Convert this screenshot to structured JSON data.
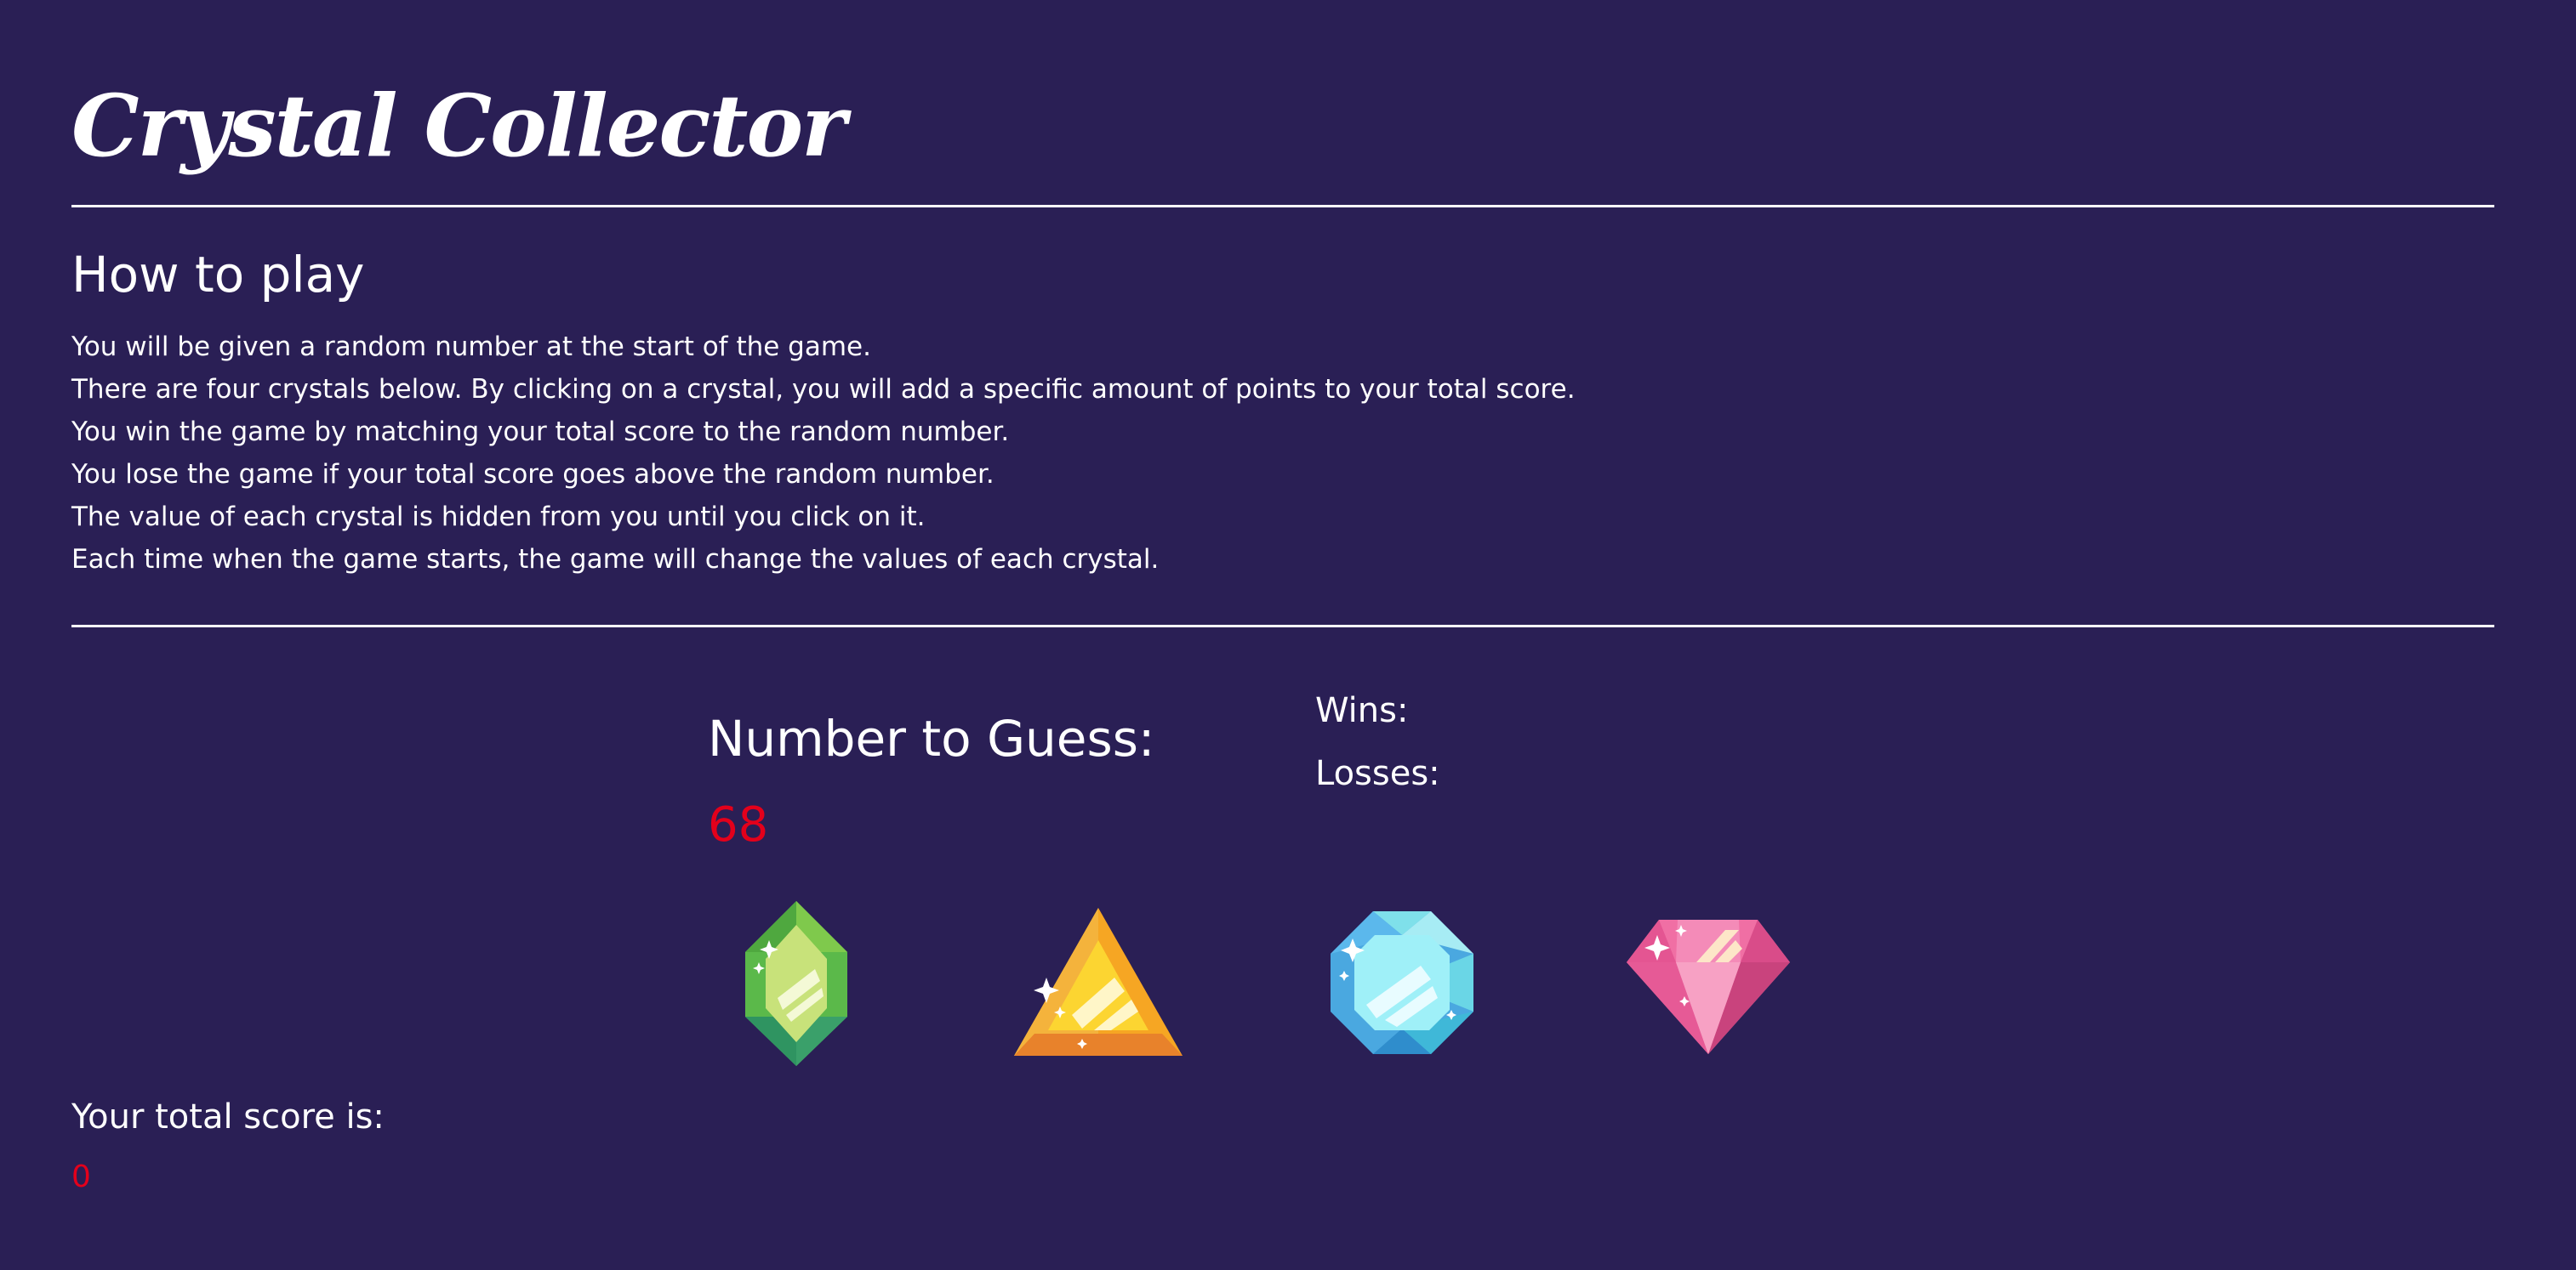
{
  "header": {
    "title": "Crystal Collector"
  },
  "instructions": {
    "heading": "How to play",
    "lines": [
      "You will be given a random number at the start of the game.",
      "There are four crystals below. By clicking on a crystal, you will add a specific amount of points to your total score.",
      "You win the game by matching your total score to the random number.",
      "You lose the game if your total score goes above the random number.",
      "The value of each crystal is hidden from you until you click on it.",
      "Each time when the game starts, the game will change the values of each crystal."
    ]
  },
  "game": {
    "guess_label": "Number to Guess:",
    "guess_value": "68",
    "wins_label": "Wins:",
    "losses_label": "Losses:",
    "score_label": "Your total score is:",
    "score_value": "0",
    "value_color": "#e3001b",
    "background_color": "#2a1f55",
    "crystals": [
      {
        "icon": "green-crystal-icon",
        "color": "#8cc63f"
      },
      {
        "icon": "orange-crystal-icon",
        "color": "#f6a623"
      },
      {
        "icon": "blue-crystal-icon",
        "color": "#5fd0e8"
      },
      {
        "icon": "pink-crystal-icon",
        "color": "#f06fa4"
      }
    ]
  }
}
